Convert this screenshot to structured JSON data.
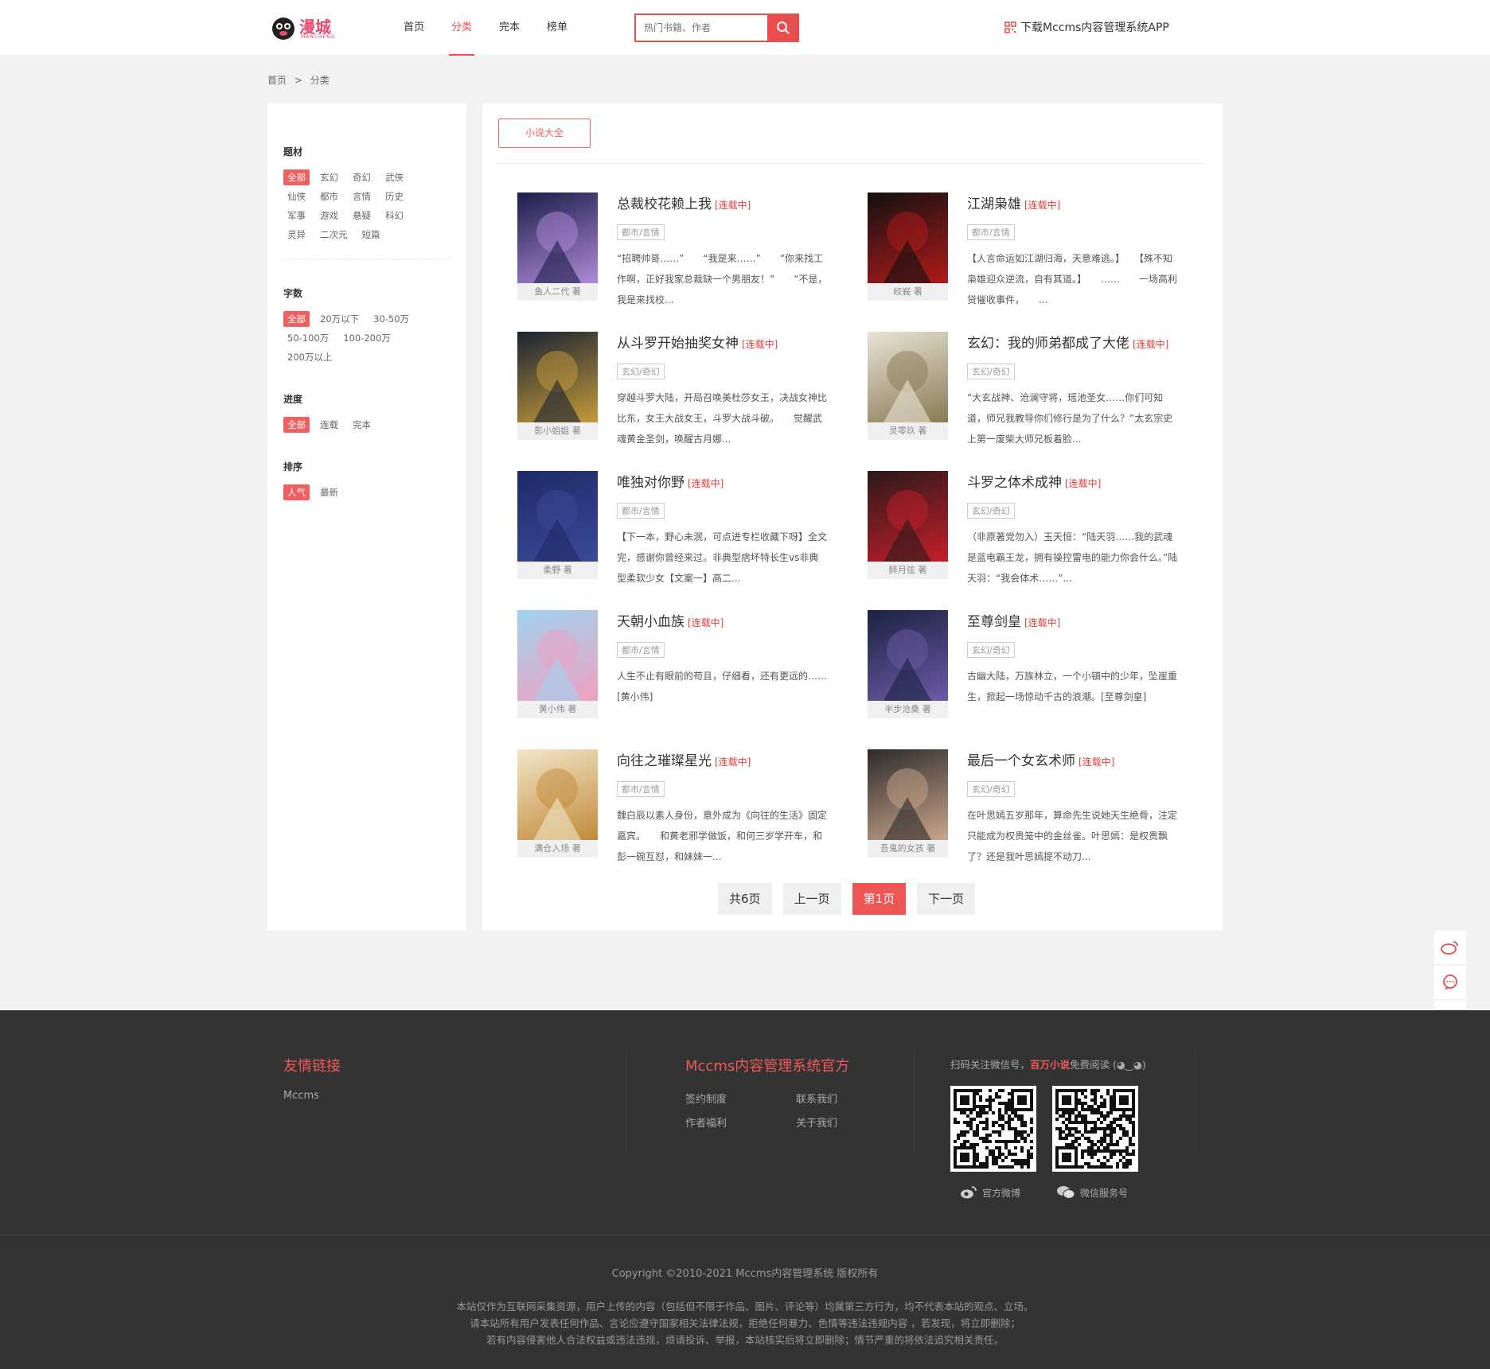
{
  "header": {
    "logo_text": "漫城",
    "logo_sub": "MANCHENG",
    "nav": [
      "首页",
      "分类",
      "完本",
      "榜单"
    ],
    "search_placeholder": "热门书籍、作者",
    "app_download": "下载Mccms内容管理系统APP"
  },
  "breadcrumb": [
    "首页",
    ">",
    "分类"
  ],
  "filters": {
    "theme": {
      "title": "题材",
      "options": [
        "全部",
        "玄幻",
        "奇幻",
        "武侠",
        "仙侠",
        "都市",
        "言情",
        "历史",
        "军事",
        "游戏",
        "悬疑",
        "科幻",
        "灵异",
        "二次元",
        "短篇"
      ]
    },
    "words": {
      "title": "字数",
      "options": [
        "全部",
        "20万以下",
        "30-50万",
        "50-100万",
        "100-200万",
        "200万以上"
      ]
    },
    "progress": {
      "title": "进度",
      "options": [
        "全部",
        "连载",
        "完本"
      ]
    },
    "sort": {
      "title": "排序",
      "options": [
        "人气",
        "最新"
      ]
    }
  },
  "main": {
    "tab": "小说大全",
    "books": [
      {
        "title": "总裁校花赖上我",
        "status": "[连载中]",
        "tag": "都市/言情",
        "author": "鱼人二代 著",
        "desc": "“招聘帅哥……”　　“我是来……”　　“你来找工作啊，正好我家总裁缺一个男朋友！”　　“不是，我是来找校..."
      },
      {
        "title": "江湖枭雄",
        "status": "[连载中]",
        "tag": "都市/言情",
        "author": "峧峩 著",
        "desc": "【人言命运如江湖归海，天意难逃。】　　【殊不知枭雄迎众逆流，自有其道。】　　……　　一场高利贷催收事件，　　..."
      },
      {
        "title": "从斗罗开始抽奖女神",
        "status": "[连载中]",
        "tag": "玄幻/奇幻",
        "author": "影小姐姐 著",
        "desc": "穿越斗罗大陆，开局召唤美杜莎女王，决战女神比比东，女王大战女王，斗罗大战斗破。　　觉醒武魂黄金圣剑，唤醒古月娜..."
      },
      {
        "title": "玄幻：我的师弟都成了大佬",
        "status": "[连载中]",
        "tag": "玄幻/奇幻",
        "author": "灵零玖 著",
        "desc": "“大玄战神、沧澜守将，瑶池圣女……你们可知道，师兄我教导你们修行是为了什么？”太玄宗史上第一废柴大师兄板着脸..."
      },
      {
        "title": "唯独对你野",
        "status": "[连载中]",
        "tag": "都市/言情",
        "author": "柔野 著",
        "desc": "【下一本，野心未泯，可点进专栏收藏下呀】全文完，感谢你曾经来过。非典型痞坏特长生vs非典型柔软少女【文案一】高二..."
      },
      {
        "title": "斗罗之体术成神",
        "status": "[连载中]",
        "tag": "玄幻/奇幻",
        "author": "醉月弦 著",
        "desc": "（非原著党勿入）玉天恒：“陆天羽……我的武魂是蓝电霸王龙，拥有操控雷电的能力你会什么。”陆天羽：“我会体术……”..."
      },
      {
        "title": "天朝小血族",
        "status": "[连载中]",
        "tag": "都市/言情",
        "author": "黄小伟 著",
        "desc": "人生不止有眼前的苟且，仔细看，还有更远的……[黄小伟]"
      },
      {
        "title": "至尊剑皇",
        "status": "[连载中]",
        "tag": "玄幻/奇幻",
        "author": "半步沧桑 著",
        "desc": "古幽大陆，万族林立，一个小镇中的少年，坠崖重生，掀起一场惊动千古的浪潮。[至尊剑皇]"
      },
      {
        "title": "向往之璀璨星光",
        "status": "[连载中]",
        "tag": "都市/言情",
        "author": "满仓入场 著",
        "desc": "魏白辰以素人身份，意外成为《向往的生活》固定嘉宾。　　和黄老邪学做饭，和何三岁学开车，和彭一碗互怼，和妹妹一..."
      },
      {
        "title": "最后一个女玄术师",
        "status": "[连载中]",
        "tag": "玄幻/奇幻",
        "author": "吾鬼的女孩 著",
        "desc": "在叶思嫣五岁那年，算命先生说她天生绝骨，注定只能成为权贵笼中的金丝雀。叶思嫣：是权贵飘了？还是我叶思嫣提不动刀..."
      }
    ],
    "pager": [
      "共6页",
      "上一页",
      "第1页",
      "下一页"
    ]
  },
  "footer": {
    "links_title": "友情链接",
    "links": [
      "Mccms"
    ],
    "official_title": "Mccms内容管理系统官方",
    "official_links": [
      "签约制度",
      "联系我们",
      "作者福利",
      "关于我们"
    ],
    "qr_prefix": "扫码关注微信号，",
    "qr_highlight": "百万小说",
    "qr_suffix": "免费阅读 (◕‿◕)",
    "weibo": "官方微博",
    "wechat": "微信服务号",
    "copyright": "Copyright ©2010-2021 Mccms内容管理系统 版权所有",
    "disclaimer": [
      "本站仅作为互联网采集资源，用户上传的内容（包括但不限于作品、图片、评论等）均属第三方行为，均不代表本站的观点、立场。",
      "请本站所有用户发表任何作品、言论应遵守国家相关法律法规，拒绝任何暴力、色情等违法违规内容 ，若发现，将立即删除；",
      "若有内容侵害他人合法权益或违法违规，烦请投诉、举报，本站核实后将立即删除；情节严重的将依法追究相关责任。"
    ]
  },
  "colors": {
    "accent": "#f05050",
    "footer_bg": "#333333",
    "page_bg": "#f2f2f2"
  }
}
